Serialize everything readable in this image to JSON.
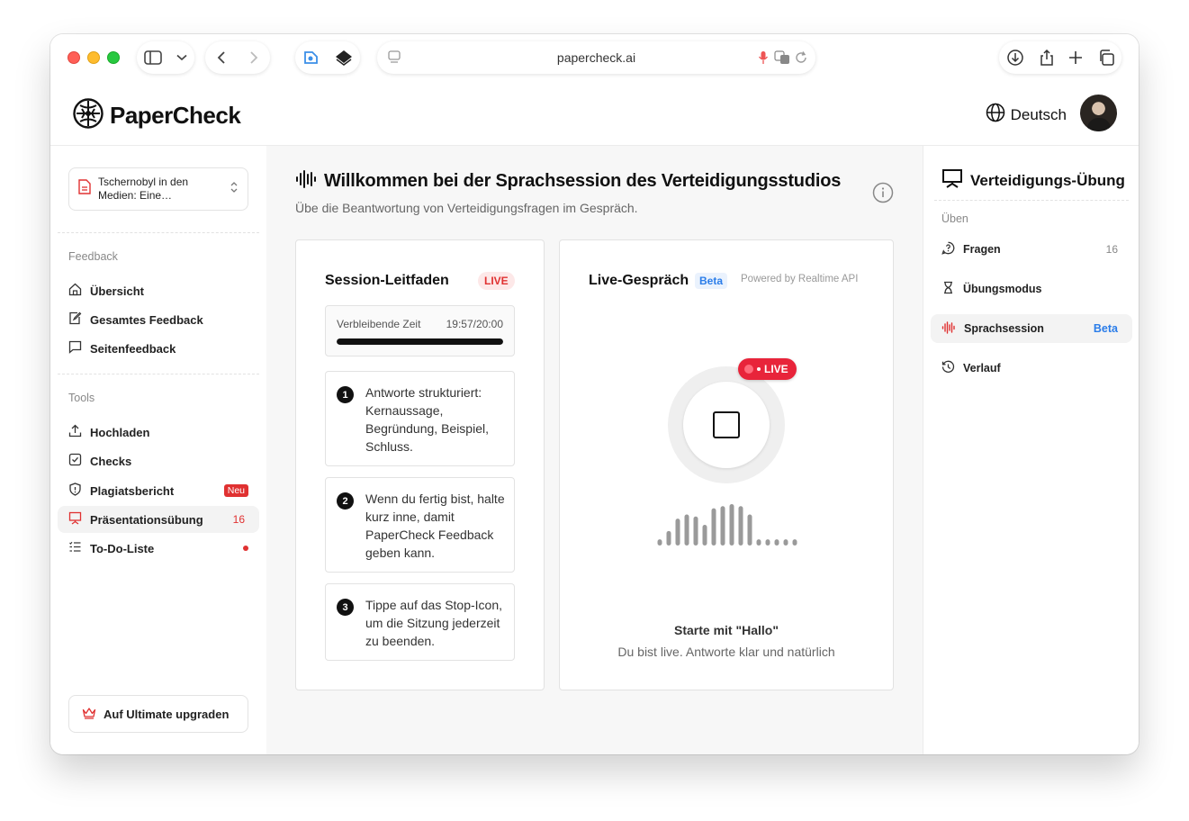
{
  "browser": {
    "url": "papercheck.ai"
  },
  "header": {
    "brand": "PaperCheck",
    "language": "Deutsch"
  },
  "sidebar": {
    "document": "Tschernobyl in den Medien: Eine…",
    "feedback_title": "Feedback",
    "feedback_items": [
      {
        "label": "Übersicht",
        "icon": "home-icon"
      },
      {
        "label": "Gesamtes Feedback",
        "icon": "edit-doc-icon"
      },
      {
        "label": "Seitenfeedback",
        "icon": "comment-icon"
      }
    ],
    "tools_title": "Tools",
    "tool_items": [
      {
        "label": "Hochladen",
        "icon": "upload-icon"
      },
      {
        "label": "Checks",
        "icon": "checkbox-icon"
      },
      {
        "label": "Plagiatsbericht",
        "icon": "shield-icon",
        "badge": "Neu"
      },
      {
        "label": "Präsentationsübung",
        "icon": "presentation-icon",
        "count": "16"
      },
      {
        "label": "To-Do-Liste",
        "icon": "list-icon"
      }
    ],
    "upgrade": "Auf Ultimate upgraden"
  },
  "main": {
    "title": "Willkommen bei der Sprachsession des Verteidigungsstudios",
    "subtitle": "Übe die Beantwortung von Verteidigungsfragen im Gespräch.",
    "guide": {
      "title": "Session-Leitfaden",
      "live": "LIVE",
      "timer_label": "Verbleibende Zeit",
      "timer_value": "19:57/20:00",
      "timer_progress": 0.9975,
      "steps": [
        {
          "n": "1",
          "text": "Antworte strukturiert: Kernaussage, Begründung, Beispiel, Schluss."
        },
        {
          "n": "2",
          "text": "Wenn du fertig bist, halte kurz inne, damit PaperCheck Feedback geben kann."
        },
        {
          "n": "3",
          "text": "Tippe auf das Stop-Icon, um die Sitzung jederzeit zu beenden."
        }
      ]
    },
    "live_chat": {
      "title": "Live-Gespräch",
      "beta": "Beta",
      "powered": "Powered by Realtime API",
      "live_pill": "LIVE",
      "wave_levels": [
        0.15,
        0.35,
        0.65,
        0.75,
        0.7,
        0.5,
        0.9,
        0.95,
        1.0,
        0.95,
        0.75,
        0.15,
        0.15,
        0.15,
        0.15,
        0.15
      ],
      "hint_title": "Starte mit \"Hallo\"",
      "hint_sub": "Du bist live. Antworte klar und natürlich"
    }
  },
  "right_panel": {
    "title": "Verteidigungs-Übung",
    "section": "Üben",
    "items": [
      {
        "label": "Fragen",
        "icon": "question-bubble-icon",
        "count": "16"
      },
      {
        "label": "Übungsmodus",
        "icon": "hourglass-icon"
      },
      {
        "label": "Sprachsession",
        "icon": "audio-wave-icon",
        "badge": "Beta"
      },
      {
        "label": "Verlauf",
        "icon": "history-icon"
      }
    ]
  },
  "colors": {
    "accent_red": "#e03131",
    "beta_blue": "#2b7de9",
    "live_red": "#e8243a"
  }
}
